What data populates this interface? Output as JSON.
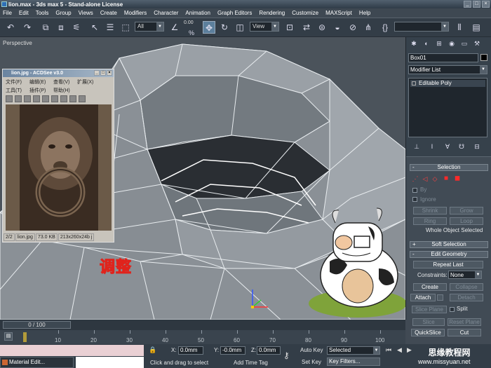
{
  "window": {
    "title": "lion.max - 3ds max 5 - Stand-alone License"
  },
  "menu": [
    "File",
    "Edit",
    "Tools",
    "Group",
    "Views",
    "Create",
    "Modifiers",
    "Character",
    "Animation",
    "Graph Editors",
    "Rendering",
    "Customize",
    "MAXScript",
    "Help"
  ],
  "toolbar": {
    "selection_filter": "All",
    "snap_value": "0.00",
    "coord_system": "View"
  },
  "viewport": {
    "label": "Perspective"
  },
  "acdsee": {
    "title": "lion.jpg - ACDSee v3.0",
    "menu_row1": [
      "文件(F)",
      "编辑(E)",
      "查看(V)",
      "扩展(X)"
    ],
    "menu_row2": [
      "工具(T)",
      "插件(P)",
      "帮助(H)"
    ],
    "status": {
      "index": "2/2",
      "file": "lion.jpg",
      "size": "73.0 KB",
      "dims": "213x260x24b j"
    }
  },
  "overlay_text": "调整",
  "command_panel": {
    "object_name": "Box01",
    "modifier_list": "Modifier List",
    "stack_item": "Editable Poly",
    "selection": {
      "header": "Selection",
      "by_vertex": "By",
      "ignore": "Ignore",
      "shrink": "Shrink",
      "grow": "Grow",
      "ring": "Ring",
      "loop": "Loop",
      "info": "Whole Object Selected"
    },
    "soft_selection": {
      "header": "Soft Selection"
    },
    "edit_geometry": {
      "header": "Edit Geometry",
      "repeat_last": "Repeat Last",
      "constraints_label": "Constraints:",
      "constraints_value": "None",
      "create": "Create",
      "collapse": "Collapse",
      "attach": "Attach",
      "detach": "Detach",
      "slice_plane": "Slice Plane",
      "split": "Split",
      "slice": "Slice",
      "reset_plane": "Reset Plane",
      "quickslice": "QuickSlice",
      "cut": "Cut"
    }
  },
  "timeline": {
    "frame_display": "0 / 100",
    "ticks": [
      "10",
      "20",
      "30",
      "40",
      "50",
      "60",
      "70",
      "80",
      "90",
      "100"
    ]
  },
  "status_bar": {
    "material_editor": "Material Edit...",
    "x_label": "X:",
    "x_value": "0.0mm",
    "y_label": "Y:",
    "y_value": "-0.0mm",
    "z_label": "Z:",
    "z_value": "0.0mm",
    "prompt": "Click and drag to select",
    "add_time_tag": "Add Time Tag",
    "auto_key": "Auto Key",
    "selected": "Selected",
    "set_key": "Set Key",
    "key_filters": "Key Filters..."
  },
  "watermark": {
    "line1": "思缘教程网",
    "line2": "www.missyuan.net"
  },
  "colors": {
    "selection_red": "#ff2a2a",
    "accent_blue": "#5c7f9c"
  }
}
